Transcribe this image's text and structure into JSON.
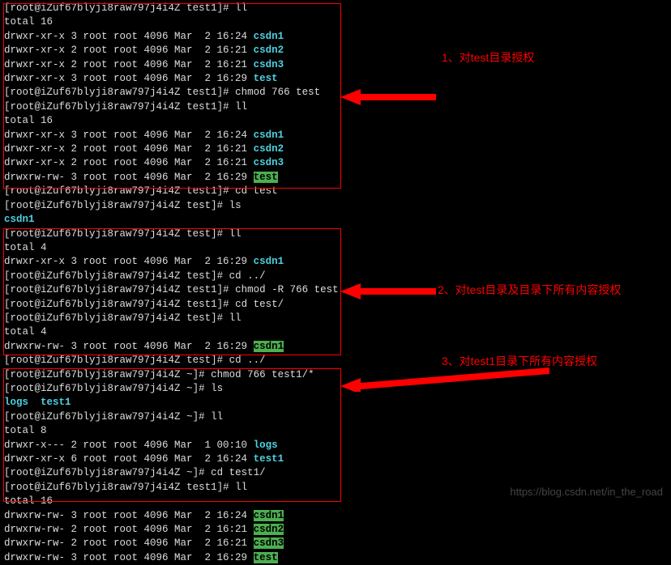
{
  "prompt": {
    "host": "root@iZuf67blyji8raw797j4i4Z"
  },
  "block1": {
    "path": "test1",
    "total": "total 16",
    "l1": "drwxr-xr-x 3 root root 4096 Mar  2 16:24 ",
    "n1": "csdn1",
    "l2": "drwxr-xr-x 2 root root 4096 Mar  2 16:21 ",
    "n2": "csdn2",
    "l3": "drwxr-xr-x 2 root root 4096 Mar  2 16:21 ",
    "n3": "csdn3",
    "l4": "drwxr-xr-x 3 root root 4096 Mar  2 16:29 ",
    "n4": "test",
    "cmd1": "chmod 766 test",
    "cmd2": "ll",
    "total2": "total 16",
    "l5": "drwxr-xr-x 3 root root 4096 Mar  2 16:24 ",
    "l6": "drwxr-xr-x 2 root root 4096 Mar  2 16:21 ",
    "l7": "drwxr-xr-x 2 root root 4096 Mar  2 16:21 ",
    "l8": "drwxrw-rw- 3 root root 4096 Mar  2 16:29 ",
    "n8": "test"
  },
  "block1b": {
    "path": "test1",
    "path2": "test",
    "cmd1": "cd test",
    "cmd2": "ls",
    "out": "csdn1"
  },
  "block2": {
    "path": "test",
    "path2": "test1",
    "cmd": "ll",
    "total": "total 4",
    "l1": "drwxr-xr-x 3 root root 4096 Mar  2 16:29 ",
    "n1": "csdn1",
    "cmd2": "cd ../",
    "cmd3": "chmod -R 766 test",
    "cmd4": "cd test/",
    "cmd5": "ll",
    "total2": "total 4",
    "l2": "drwxrw-rw- 3 root root 4096 Mar  2 16:29 ",
    "n2": "csdn1"
  },
  "block2b": {
    "path": "test",
    "cmd": "cd ../"
  },
  "block3": {
    "path": "~",
    "path1": "test1",
    "cmd1": "chmod 766 test1/*",
    "cmd2": "ls",
    "out1": "logs",
    "out2": "test1",
    "cmd3": "ll",
    "total": "total 8",
    "l1": "drwxr-x--- 2 root root 4096 Mar  1 00:10 ",
    "n1": "logs",
    "l2": "drwxr-xr-x 6 root root 4096 Mar  2 16:24 ",
    "n2": "test1",
    "cmd4": "cd test1/",
    "cmd5": "ll",
    "total2": "total 16",
    "l3": "drwxrw-rw- 3 root root 4096 Mar  2 16:24 ",
    "n3": "csdn1",
    "l4": "drwxrw-rw- 2 root root 4096 Mar  2 16:21 ",
    "n4": "csdn2",
    "l5": "drwxrw-rw- 2 root root 4096 Mar  2 16:21 ",
    "n5": "csdn3",
    "l6": "drwxrw-rw- 3 root root 4096 Mar  2 16:29 ",
    "n6": "test"
  },
  "anno": {
    "a1": "1、对test目录授权",
    "a2": "2、对test目录及目录下所有内容授权",
    "a3": "3、对test1目录下所有内容授权"
  },
  "watermark": "https://blog.csdn.net/in_the_road"
}
